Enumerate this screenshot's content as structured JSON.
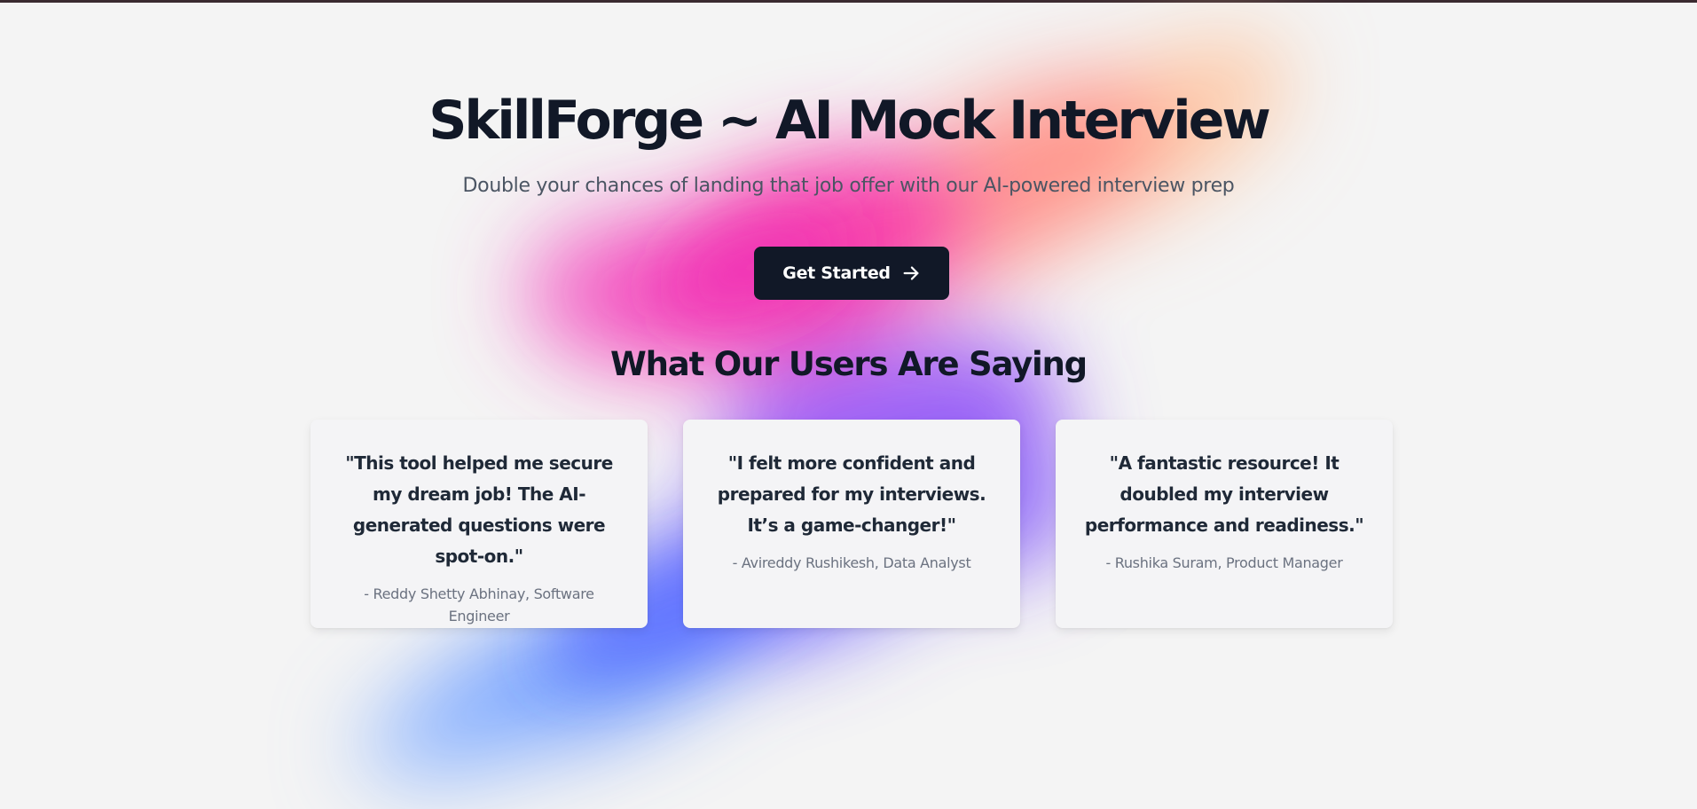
{
  "hero": {
    "title": "SkillForge ~ AI Mock Interview",
    "subtitle": "Double your chances of landing that job offer with our AI-powered interview prep",
    "cta_label": "Get Started",
    "cta_icon": "arrow-right-icon"
  },
  "testimonials": {
    "heading": "What Our Users Are Saying",
    "items": [
      {
        "quote": "\"This tool helped me secure my dream job! The AI-generated questions were spot-on.\"",
        "author": "- Reddy Shetty Abhinay, Software Engineer"
      },
      {
        "quote": "\"I felt more confident and prepared for my interviews. It’s a game-changer!\"",
        "author": "- Avireddy Rushikesh, Data Analyst"
      },
      {
        "quote": "\"A fantastic resource! It doubled my interview performance and readiness.\"",
        "author": "- Rushika Suram, Product Manager"
      }
    ]
  },
  "colors": {
    "background": "#f4f4f4",
    "button": "#111827",
    "heading_text": "#111827",
    "muted_text": "#6b7280",
    "gradient_pink": "#f23bb8",
    "gradient_orange": "#ff9a7a",
    "gradient_purple": "#8b5cf6",
    "gradient_blue": "#5b8cff"
  }
}
